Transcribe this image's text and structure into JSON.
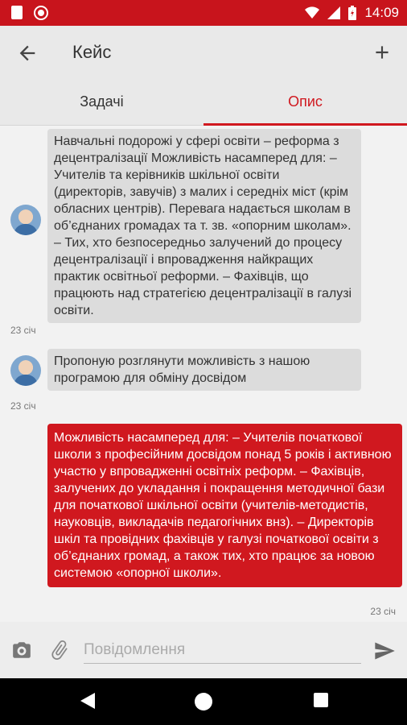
{
  "status_bar": {
    "time": "14:09"
  },
  "header": {
    "title": "Кейс"
  },
  "tabs": [
    {
      "label": "Задачі",
      "active": false
    },
    {
      "label": "Опис",
      "active": true
    }
  ],
  "messages": [
    {
      "direction": "incoming",
      "text": "Навчальні подорожі у сфері освіти – реформа з децентралізації Можливість насамперед для: – Учителів та керівників шкільної освіти (директорів, завучів) з малих і середніх міст (крім обласних центрів). Перевага надається школам в об’єднаних громадах та т. зв. «опорним школам». – Тих, хто безпосередньо залучений до процесу децентралізації і впровадження найкращих практик освітньої реформи. – Фахівців, що працюють над стратегією децентралізації в галузі освіти.",
      "time": "23 січ"
    },
    {
      "direction": "incoming",
      "text": "Пропоную розглянути можливість з нашою програмою для обміну досвідом",
      "time": "23 січ"
    },
    {
      "direction": "outgoing",
      "text": "Можливість насамперед для: – Учителів початкової школи з професійним досвідом понад 5 років і активною участю у впровадженні освітніх реформ. – Фахівців, залучених до укладання і покращення методичної бази для початкової шкільної освіти (учителів-методистів, науковців, викладачів педагогічних внз). – Директорів шкіл та провідних фахівців у галузі початкової освіти з об’єднаних громад, а також тих, хто працює за новою системою «опорної школи».",
      "time": "23 січ"
    }
  ],
  "composer": {
    "placeholder": "Повідомлення"
  },
  "colors": {
    "accent": "#d0181f",
    "status_bar": "#c8141c",
    "incoming_bubble": "#dcdcdc"
  }
}
